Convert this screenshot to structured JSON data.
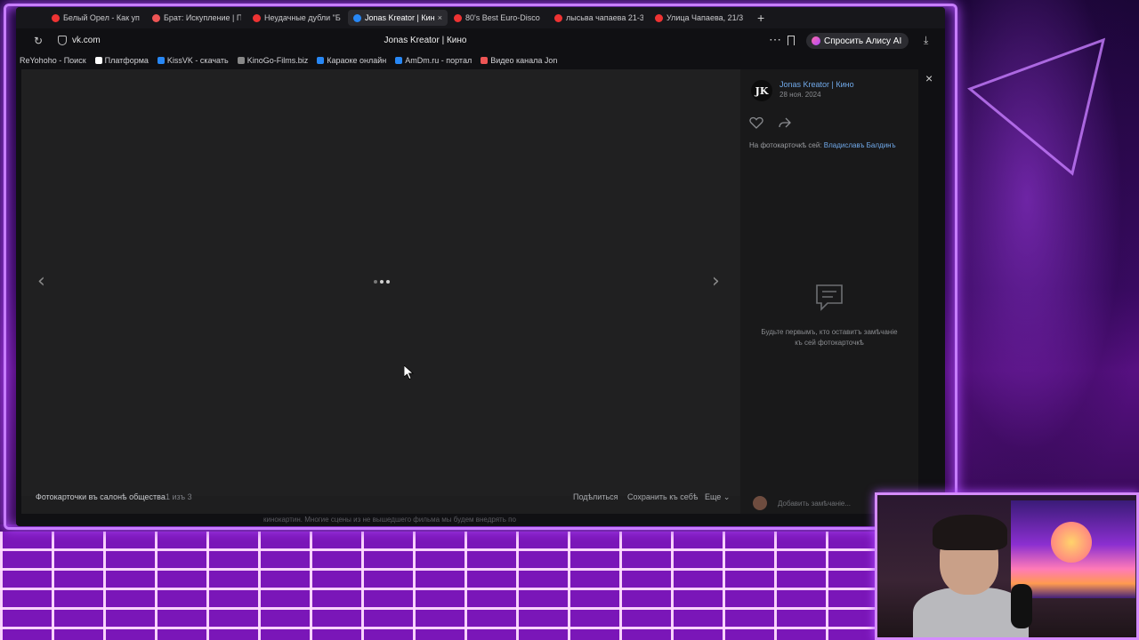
{
  "browser": {
    "tabs": [
      {
        "label": "Белый Орел - Как уп",
        "color": "#e33"
      },
      {
        "label": "Брат: Искупление | П",
        "color": "#e55"
      },
      {
        "label": "Неудачные дубли \"Б",
        "color": "#e33"
      },
      {
        "label": "Jonas Kreator | Кин",
        "color": "#2787f5",
        "active": true
      },
      {
        "label": "80's Best Euro-Disco",
        "color": "#e33"
      },
      {
        "label": "лысьва чапаева 21-3",
        "color": "#e33"
      },
      {
        "label": "Улица Чапаева, 21/3",
        "color": "#e33"
      }
    ],
    "tab_close": "×",
    "tab_add": "+",
    "url": "vk.com",
    "page_title": "Jonas Kreator | Кино",
    "alice_label": "Спросить Алису AI",
    "bookmarks": [
      {
        "label": "ReYohoho - Поиск",
        "color": "#333"
      },
      {
        "label": "Платформа",
        "color": "#fff"
      },
      {
        "label": "KissVK - скачать",
        "color": "#2787f5"
      },
      {
        "label": "KinoGo-Films.biz",
        "color": "#888"
      },
      {
        "label": "Караоке онлайн",
        "color": "#2787f5"
      },
      {
        "label": "AmDm.ru - портал",
        "color": "#2787f5"
      },
      {
        "label": "Видео канала Jon",
        "color": "#e55"
      }
    ]
  },
  "viewer": {
    "author": "Jonas Kreator | Кино",
    "avatar_text": "JK",
    "date": "28 ноя. 2024",
    "tagged_prefix": "На фотокарточкѣ сей:",
    "tagged_name": "Владиславъ Балдинъ",
    "empty_comments": "Будьте первымъ, кто оставитъ замѣчаніе къ сей фотокарточкѣ",
    "comment_placeholder": "Добавить замѣчаніе...",
    "album_title": "Фотокарточки въ салонѣ общества",
    "album_count": "1 изъ 3",
    "share_label": "Подѣлиться",
    "save_label": "Сохранить къ себѣ",
    "more_label": "Еще",
    "close_symbol": "×",
    "prev_symbol": "‹",
    "next_symbol": "›"
  },
  "background_text": "кинокартин. Многие сцены из не вышедшего фильма мы будем внедрять по",
  "colors": {
    "accent_link": "#71aaeb",
    "neon": "#c77dff"
  }
}
